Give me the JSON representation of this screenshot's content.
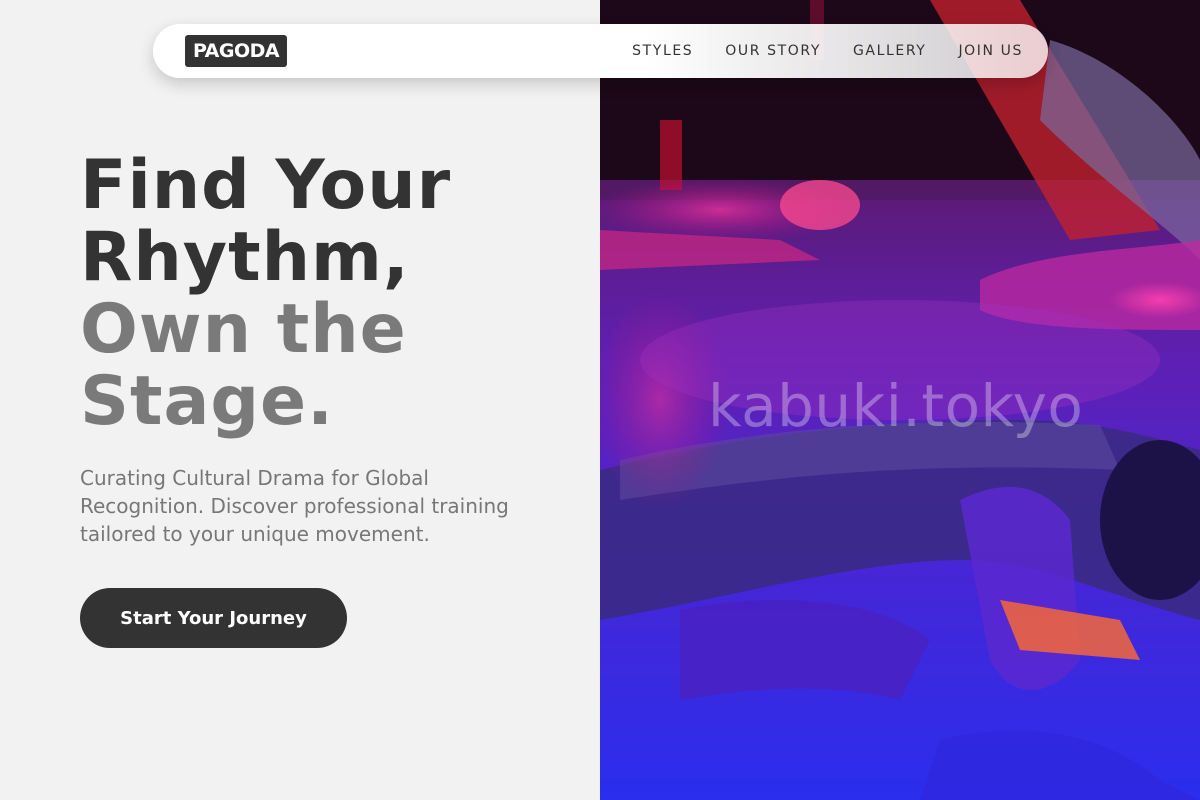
{
  "brand": {
    "logo_text": "PAGODA"
  },
  "nav": {
    "links": [
      {
        "label": "STYLES"
      },
      {
        "label": "OUR STORY"
      },
      {
        "label": "GALLERY"
      },
      {
        "label": "JOIN US"
      }
    ]
  },
  "hero": {
    "title_line1": "Find Your",
    "title_line2": "Rhythm,",
    "title_line3": "Own the",
    "title_line4": "Stage.",
    "subtitle": "Curating Cultural Drama for Global Recognition. Discover professional training tailored to your unique movement.",
    "cta_label": "Start Your Journey"
  },
  "photo": {
    "watermark": "kabuki.tokyo"
  },
  "colors": {
    "background": "#f2f2f2",
    "text_dark": "#333333",
    "text_light": "#7a7a7a",
    "button_bg": "#333333",
    "photo_magenta": "#c020a0",
    "photo_blue": "#3a18d0"
  }
}
